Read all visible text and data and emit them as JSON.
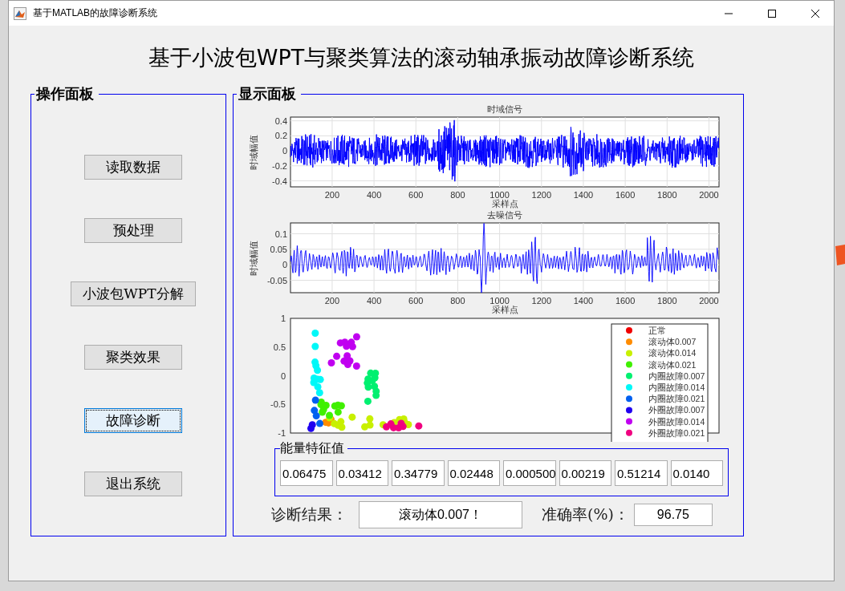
{
  "window": {
    "title": "基于MATLAB的故障诊断系统"
  },
  "heading": "基于小波包WPT与聚类算法的滚动轴承振动故障诊断系统",
  "control_panel": {
    "title": "操作面板",
    "buttons": [
      {
        "label": "读取数据",
        "focused": false
      },
      {
        "label": "预处理",
        "focused": false
      },
      {
        "label": "小波包WPT分解",
        "focused": false
      },
      {
        "label": "聚类效果",
        "focused": false
      },
      {
        "label": "故障诊断",
        "focused": true
      },
      {
        "label": "退出系统",
        "focused": false
      }
    ]
  },
  "display_panel": {
    "title": "显示面板",
    "plots": [
      {
        "kind": "raw",
        "title": "时域信号",
        "xlabel": "采样点",
        "ylabel": "时域幅值",
        "yticks": [
          "0.4",
          "0.2",
          "0",
          "-0.2",
          "-0.4"
        ],
        "xticks": [
          "200",
          "400",
          "600",
          "800",
          "1000",
          "1200",
          "1400",
          "1600",
          "1800",
          "2000"
        ]
      },
      {
        "kind": "denoised",
        "title": "去噪信号",
        "xlabel": "采样点",
        "ylabel": "时域幅值",
        "yticks": [
          "0.1",
          "0.05",
          "0",
          "-0.05"
        ],
        "xticks": [
          "200",
          "400",
          "600",
          "800",
          "1000",
          "1200",
          "1400",
          "1600",
          "1800",
          "2000"
        ]
      }
    ],
    "cluster_plot": {
      "yticks": [
        "1",
        "0.5",
        "0",
        "-0.5",
        "-1"
      ],
      "legend": [
        {
          "label": "正常",
          "color": "#f00000"
        },
        {
          "label": "滚动体0.007",
          "color": "#ff8c00"
        },
        {
          "label": "滚动体0.014",
          "color": "#c8f000"
        },
        {
          "label": "滚动体0.021",
          "color": "#40f000"
        },
        {
          "label": "内圈故障0.007",
          "color": "#00f070"
        },
        {
          "label": "内圈故障0.014",
          "color": "#00f8f8"
        },
        {
          "label": "内圈故障0.021",
          "color": "#0060f0"
        },
        {
          "label": "外圈故障0.007",
          "color": "#2000f0"
        },
        {
          "label": "外圈故障0.014",
          "color": "#c000f0"
        },
        {
          "label": "外圈故障0.021",
          "color": "#f00080"
        }
      ]
    },
    "energy_features": {
      "title": "能量特征值",
      "values": [
        "0.06475",
        "0.03412",
        "0.34779",
        "0.02448",
        "0.000500",
        "0.00219",
        "0.51214",
        "0.0140"
      ]
    },
    "diagnosis": {
      "label": "诊断结果：",
      "value": "滚动体0.007！",
      "accuracy_label": "准确率(%)：",
      "accuracy": "96.75"
    }
  }
}
